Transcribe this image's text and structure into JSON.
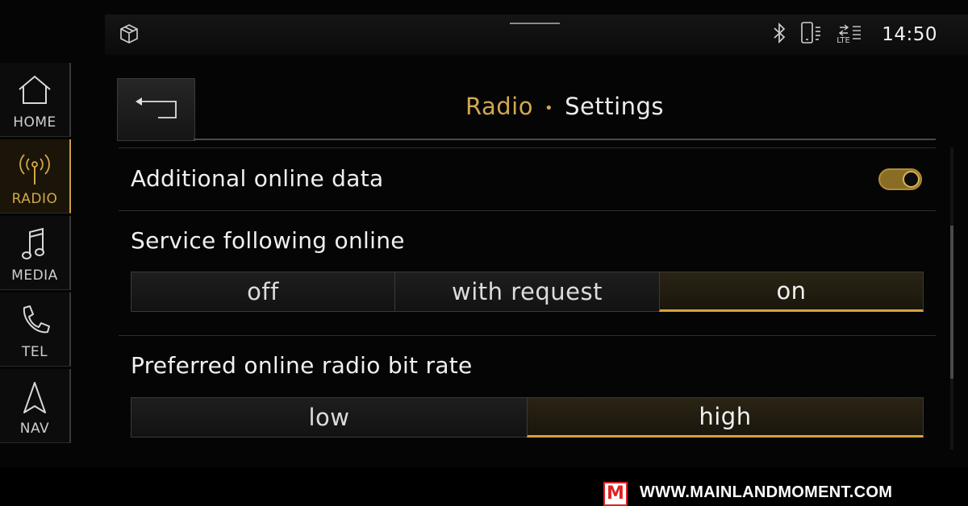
{
  "status_bar": {
    "time": "14:50",
    "lte_label": "LTE",
    "icons": [
      "car-3d-icon",
      "bluetooth-icon",
      "phone-icon",
      "lte-icon"
    ]
  },
  "nav": {
    "items": [
      {
        "label": "HOME",
        "icon": "home-icon"
      },
      {
        "label": "RADIO",
        "icon": "radio-icon",
        "active": true
      },
      {
        "label": "MEDIA",
        "icon": "music-note-icon"
      },
      {
        "label": "TEL",
        "icon": "phone-handset-icon"
      },
      {
        "label": "NAV",
        "icon": "navigation-arrow-icon"
      }
    ]
  },
  "header": {
    "section": "Radio",
    "separator": "•",
    "page": "Settings",
    "back_icon": "back-arrow-icon"
  },
  "settings": {
    "additional_online_data": {
      "label": "Additional online data",
      "enabled": true
    },
    "service_following": {
      "label": "Service following online",
      "options": [
        "off",
        "with request",
        "on"
      ],
      "selected": "on"
    },
    "bit_rate": {
      "label": "Preferred online radio bit rate",
      "options": [
        "low",
        "high"
      ],
      "selected": "high"
    }
  },
  "footer": {
    "logo_letter": "M",
    "url": "WWW.MAINLANDMOMENT.COM"
  },
  "colors": {
    "accent": "#d4a33c",
    "background": "#050505",
    "text": "#f0f0f0"
  }
}
